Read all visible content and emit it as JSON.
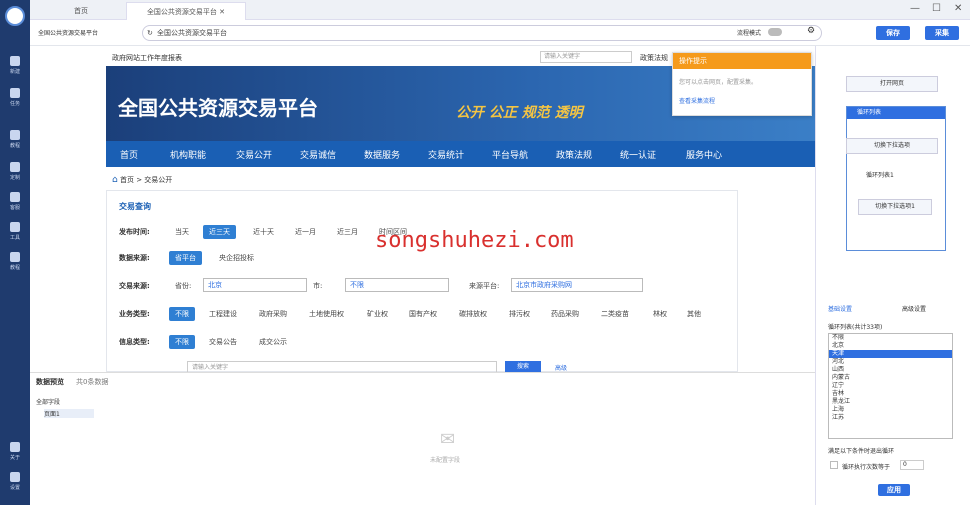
{
  "tabs": [
    "首页",
    "全国公共资源交易平台"
  ],
  "window_controls": [
    "—",
    "☐",
    "✕"
  ],
  "address": {
    "site_name": "全国公共资源交易平台",
    "url": "全国公共资源交易平台",
    "flow_mode": "流程模式",
    "save": "保存",
    "collect": "采集"
  },
  "sidebar": {
    "items": [
      "新建",
      "任务",
      "教程",
      "定制",
      "客服",
      "工具",
      "教程",
      "关于",
      "设置"
    ]
  },
  "site": {
    "top_link": "政府网站工作年度报表",
    "search_placeholder": "请输入关键字",
    "policy_link": "政策法规",
    "title": "全国公共资源交易平台",
    "slogan": "公开  公正  规范  透明",
    "nav": [
      "首页",
      "机构职能",
      "交易公开",
      "交易诚信",
      "数据服务",
      "交易统计",
      "平台导航",
      "政策法规",
      "统一认证",
      "服务中心"
    ],
    "breadcrumb": [
      "首页",
      ">",
      "交易公开"
    ],
    "panel_title": "交易查询",
    "publish_time": {
      "label": "发布时间:",
      "options": [
        "当天",
        "近三天",
        "近十天",
        "近一月",
        "近三月",
        "时间区间"
      ]
    },
    "data_source": {
      "label": "数据来源:",
      "options": [
        "省平台",
        "央企招投标"
      ]
    },
    "trade_source": {
      "label": "交易来源:",
      "province": "省份:",
      "province_val": "北京",
      "city": "市:",
      "city_val": "不限",
      "platform": "来源平台:",
      "platform_val": "北京市政府采购网"
    },
    "biz_type": {
      "label": "业务类型:",
      "options": [
        "不限",
        "工程建设",
        "政府采购",
        "土地使用权",
        "矿业权",
        "国有产权",
        "碳排放权",
        "排污权",
        "药品采购",
        "二类疫苗",
        "林权",
        "其他"
      ]
    },
    "info_type": {
      "label": "信息类型:",
      "options": [
        "不限",
        "交易公告",
        "成交公示"
      ]
    },
    "search_input": "请输入关键字",
    "search_btn": "搜索",
    "advanced": "高级"
  },
  "popup": {
    "title": "操作提示",
    "text": "您可以点击网页，配置采集。",
    "link": "查看采集流程"
  },
  "watermark": "songshuhezi.com",
  "bottom": {
    "tab1": "数据预览",
    "tab2": "共0条数据",
    "tree_root": "全部字段",
    "tree_child": "页面1",
    "empty": "未配置字段"
  },
  "right": {
    "open_page": "打开网页",
    "loop_list": "循环列表",
    "switch1": "切换下拉选项",
    "loop_list1": "循环列表1",
    "switch2": "切换下拉选项1",
    "tab_basic": "基础设置",
    "tab_adv": "高级设置",
    "loop_label": "循环列表(共计33项)",
    "list": [
      "不限",
      "北京",
      "天津",
      "河北",
      "山西",
      "内蒙古",
      "辽宁",
      "吉林",
      "黑龙江",
      "上海",
      "江苏"
    ],
    "exit_label": "满足以下条件时退出循环",
    "exit_opt": "循环执行次数等于",
    "exit_val": "0",
    "apply": "应用"
  }
}
